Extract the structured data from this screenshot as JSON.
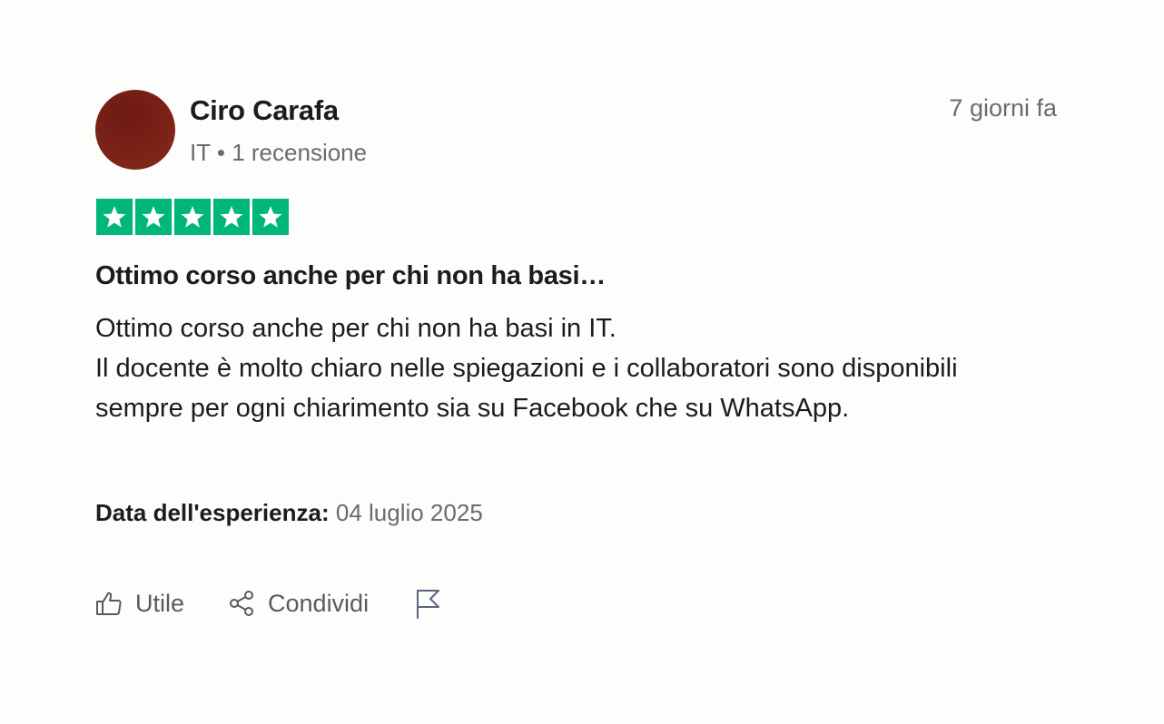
{
  "reviewer": {
    "name": "Ciro Carafa",
    "country": "IT",
    "separator": "•",
    "reviews_count": "1 recensione"
  },
  "review": {
    "time_ago": "7 giorni fa",
    "rating": 5,
    "rating_max": 5,
    "star_color": "#00b67a",
    "title": "Ottimo corso anche per chi non ha basi…",
    "body": "Ottimo corso anche per chi non ha basi in IT.\nIl docente è molto chiaro nelle spiegazioni e i collaboratori sono disponibili sempre per ogni chiarimento sia su Facebook che su WhatsApp.",
    "experience_label": "Data dell'esperienza:",
    "experience_date": "04 luglio 2025"
  },
  "actions": {
    "useful_label": "Utile",
    "useful_icon": "thumbs-up-icon",
    "share_label": "Condividi",
    "share_icon": "share-icon",
    "report_icon": "flag-icon"
  }
}
